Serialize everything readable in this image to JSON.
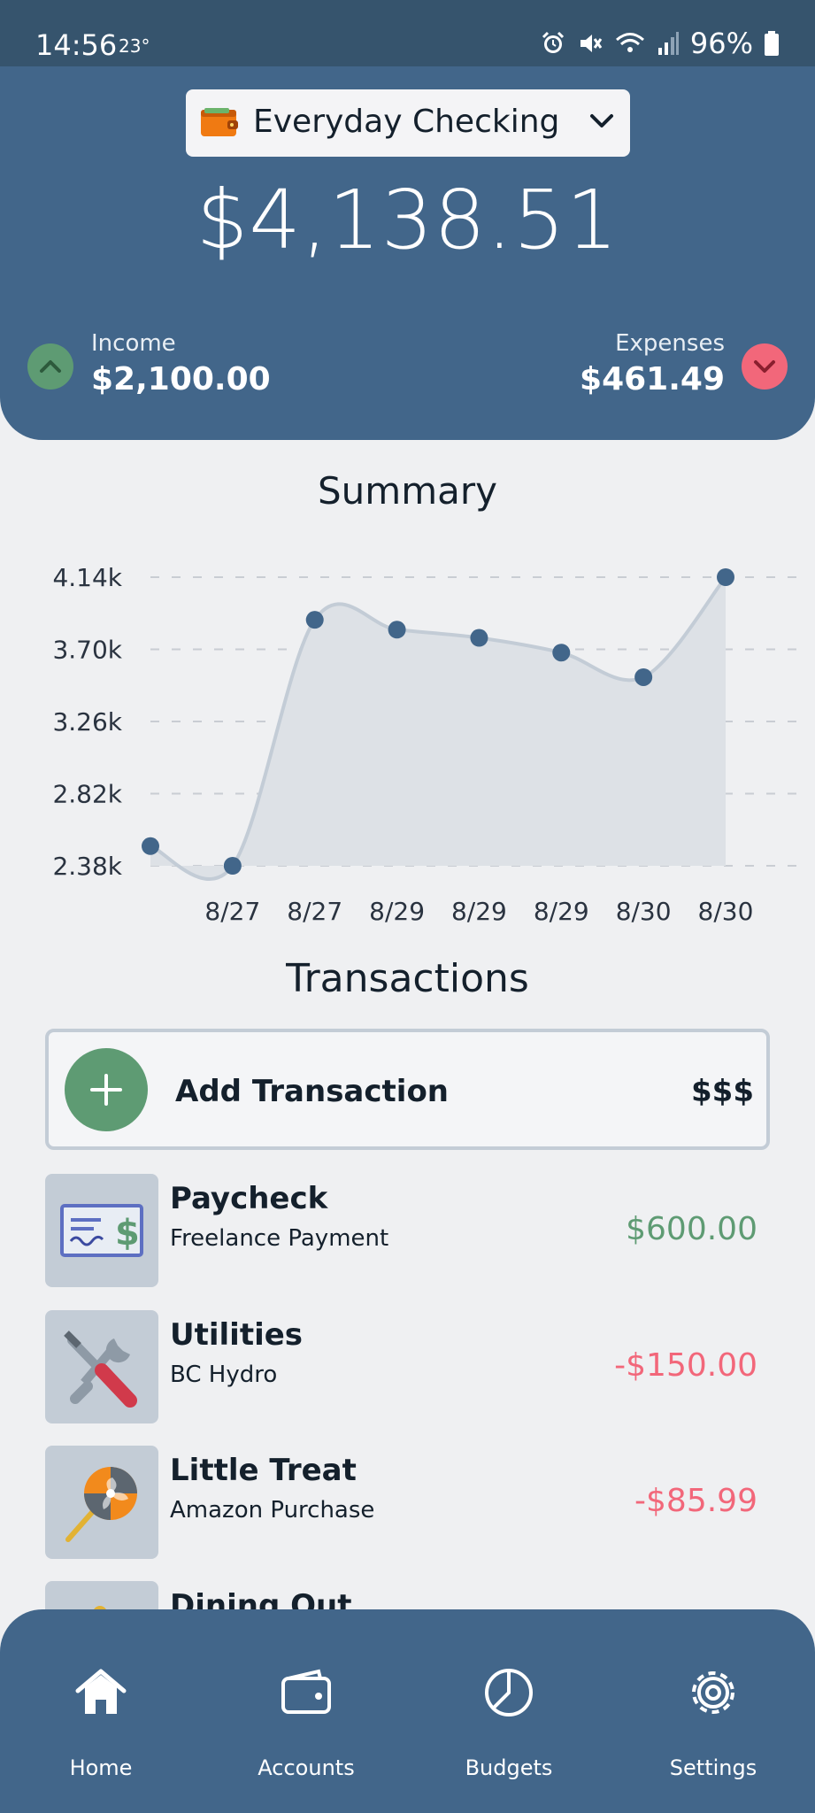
{
  "status_bar": {
    "time": "14:56",
    "temperature": "23°",
    "battery": "96%"
  },
  "header": {
    "account_name": "Everyday Checking",
    "balance": "$4,138.51",
    "income_label": "Income",
    "income_value": "$2,100.00",
    "expenses_label": "Expenses",
    "expenses_value": "$461.49"
  },
  "summary": {
    "title": "Summary"
  },
  "chart_data": {
    "type": "area",
    "title": "Summary",
    "y_ticks": [
      "4.14k",
      "3.70k",
      "3.26k",
      "2.82k",
      "2.38k"
    ],
    "ylim": [
      2.38,
      4.14
    ],
    "x_labels": [
      "8/27",
      "8/27",
      "8/29",
      "8/29",
      "8/29",
      "8/30",
      "8/30"
    ],
    "values": [
      2.5,
      2.38,
      3.88,
      3.82,
      3.77,
      3.68,
      3.53,
      4.14
    ],
    "grid": true,
    "colors": {
      "line": "#c3ccd6",
      "fill": "#dde1e6",
      "point": "#42668a"
    }
  },
  "transactions": {
    "title": "Transactions",
    "add_label": "Add Transaction",
    "add_money": "$$$",
    "items": [
      {
        "name": "Paycheck",
        "description": "Freelance Payment",
        "amount": "$600.00",
        "type": "income",
        "icon": "check-icon"
      },
      {
        "name": "Utilities",
        "description": "BC Hydro",
        "amount": "-$150.00",
        "type": "expense",
        "icon": "tools-icon"
      },
      {
        "name": "Little Treat",
        "description": "Amazon Purchase",
        "amount": "-$85.99",
        "type": "expense",
        "icon": "lollipop-icon"
      },
      {
        "name": "Dining Out",
        "description": "",
        "amount": "",
        "type": "expense",
        "icon": "dining-icon"
      }
    ]
  },
  "nav": [
    {
      "label": "Home",
      "icon": "home-icon"
    },
    {
      "label": "Accounts",
      "icon": "wallet-icon"
    },
    {
      "label": "Budgets",
      "icon": "pie-chart-icon"
    },
    {
      "label": "Settings",
      "icon": "gear-icon"
    }
  ],
  "colors": {
    "primary": "#42668a",
    "income": "#5e9b73",
    "expense": "#f2677a",
    "background": "#eff0f2"
  }
}
